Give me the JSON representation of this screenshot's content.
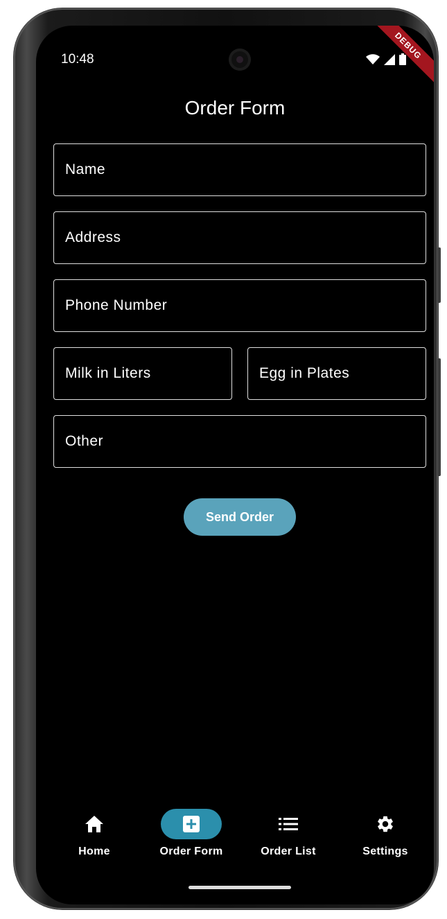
{
  "status_bar": {
    "time": "10:48",
    "debug_label": "DEBUG"
  },
  "page": {
    "title": "Order Form"
  },
  "form": {
    "name_placeholder": "Name",
    "address_placeholder": "Address",
    "phone_placeholder": "Phone Number",
    "milk_placeholder": "Milk in Liters",
    "egg_placeholder": "Egg in Plates",
    "other_placeholder": "Other",
    "send_label": "Send Order"
  },
  "bottom_nav": {
    "items": [
      {
        "label": "Home",
        "icon": "home-icon",
        "active": false
      },
      {
        "label": "Order Form",
        "icon": "add-box-icon",
        "active": true
      },
      {
        "label": "Order List",
        "icon": "list-icon",
        "active": false
      },
      {
        "label": "Settings",
        "icon": "gear-icon",
        "active": false
      }
    ]
  },
  "colors": {
    "background": "#000000",
    "accent": "#2b8fac",
    "button": "#5aa3bb",
    "field_border": "#e0e0e0",
    "debug_ribbon": "#a3161f"
  }
}
